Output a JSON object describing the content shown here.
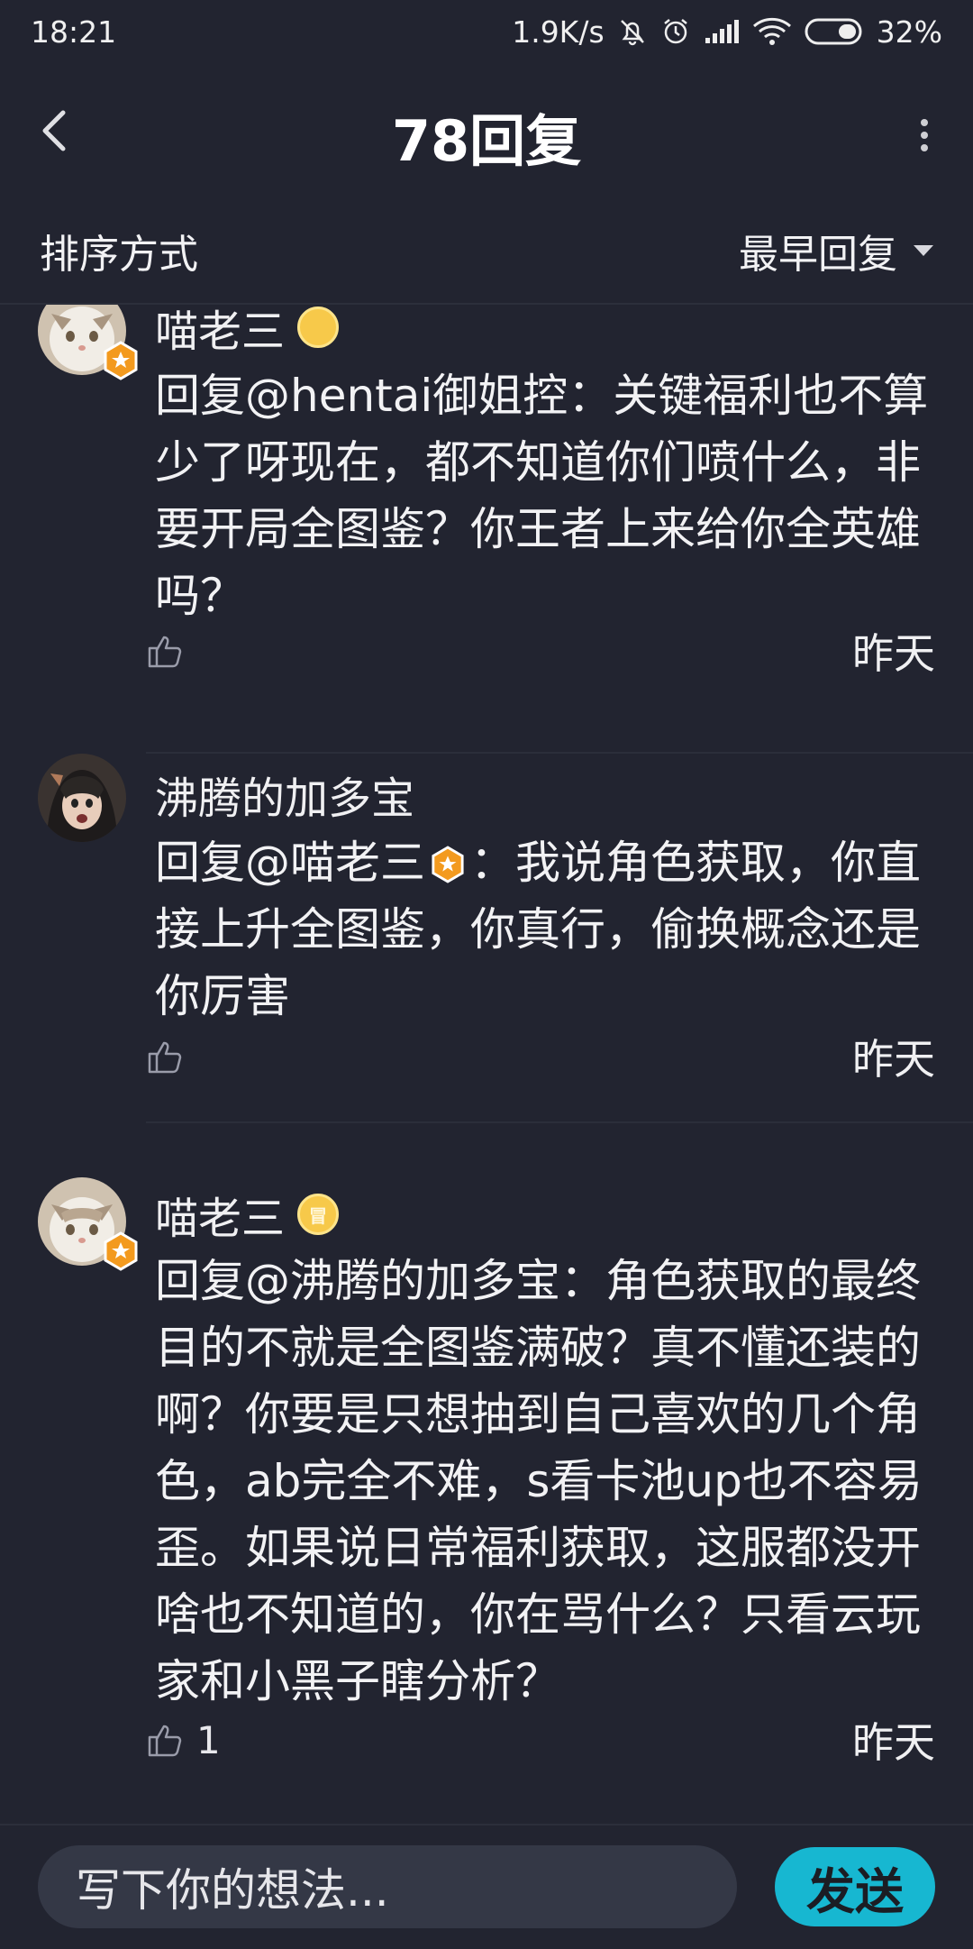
{
  "status": {
    "time": "18:21",
    "speed": "1.9K/s",
    "battery": "32%"
  },
  "header": {
    "title": "78回复"
  },
  "sort": {
    "label": "排序方式",
    "selected": "最早回复"
  },
  "comments": [
    {
      "username": "喵老三",
      "text": "回复@hentai御姐控：关键福利也不算少了呀现在，都不知道你们喷什么，非要开局全图鉴？你王者上来给你全英雄吗？",
      "likes": "",
      "time": "昨天"
    },
    {
      "username": "沸腾的加多宝",
      "text_prefix": "回复@喵老三",
      "text_suffix": "：我说角色获取，你直接上升全图鉴，你真行，偷换概念还是你厉害",
      "likes": "",
      "time": "昨天"
    },
    {
      "username": "喵老三",
      "level_badge": "冒",
      "text": "回复@沸腾的加多宝：角色获取的最终目的不就是全图鉴满破？真不懂还装的啊？你要是只想抽到自己喜欢的几个角色，ab完全不难，s看卡池up也不容易歪。如果说日常福利获取，这服都没开啥也不知道的，你在骂什么？只看云玩家和小黑子瞎分析？",
      "likes": "1",
      "time": "昨天"
    }
  ],
  "composer": {
    "placeholder": "写下你的想法...",
    "send_label": "发送"
  },
  "colors": {
    "background": "#222430",
    "accent": "#17b7d1",
    "vip_badge": "#f39a1e"
  }
}
